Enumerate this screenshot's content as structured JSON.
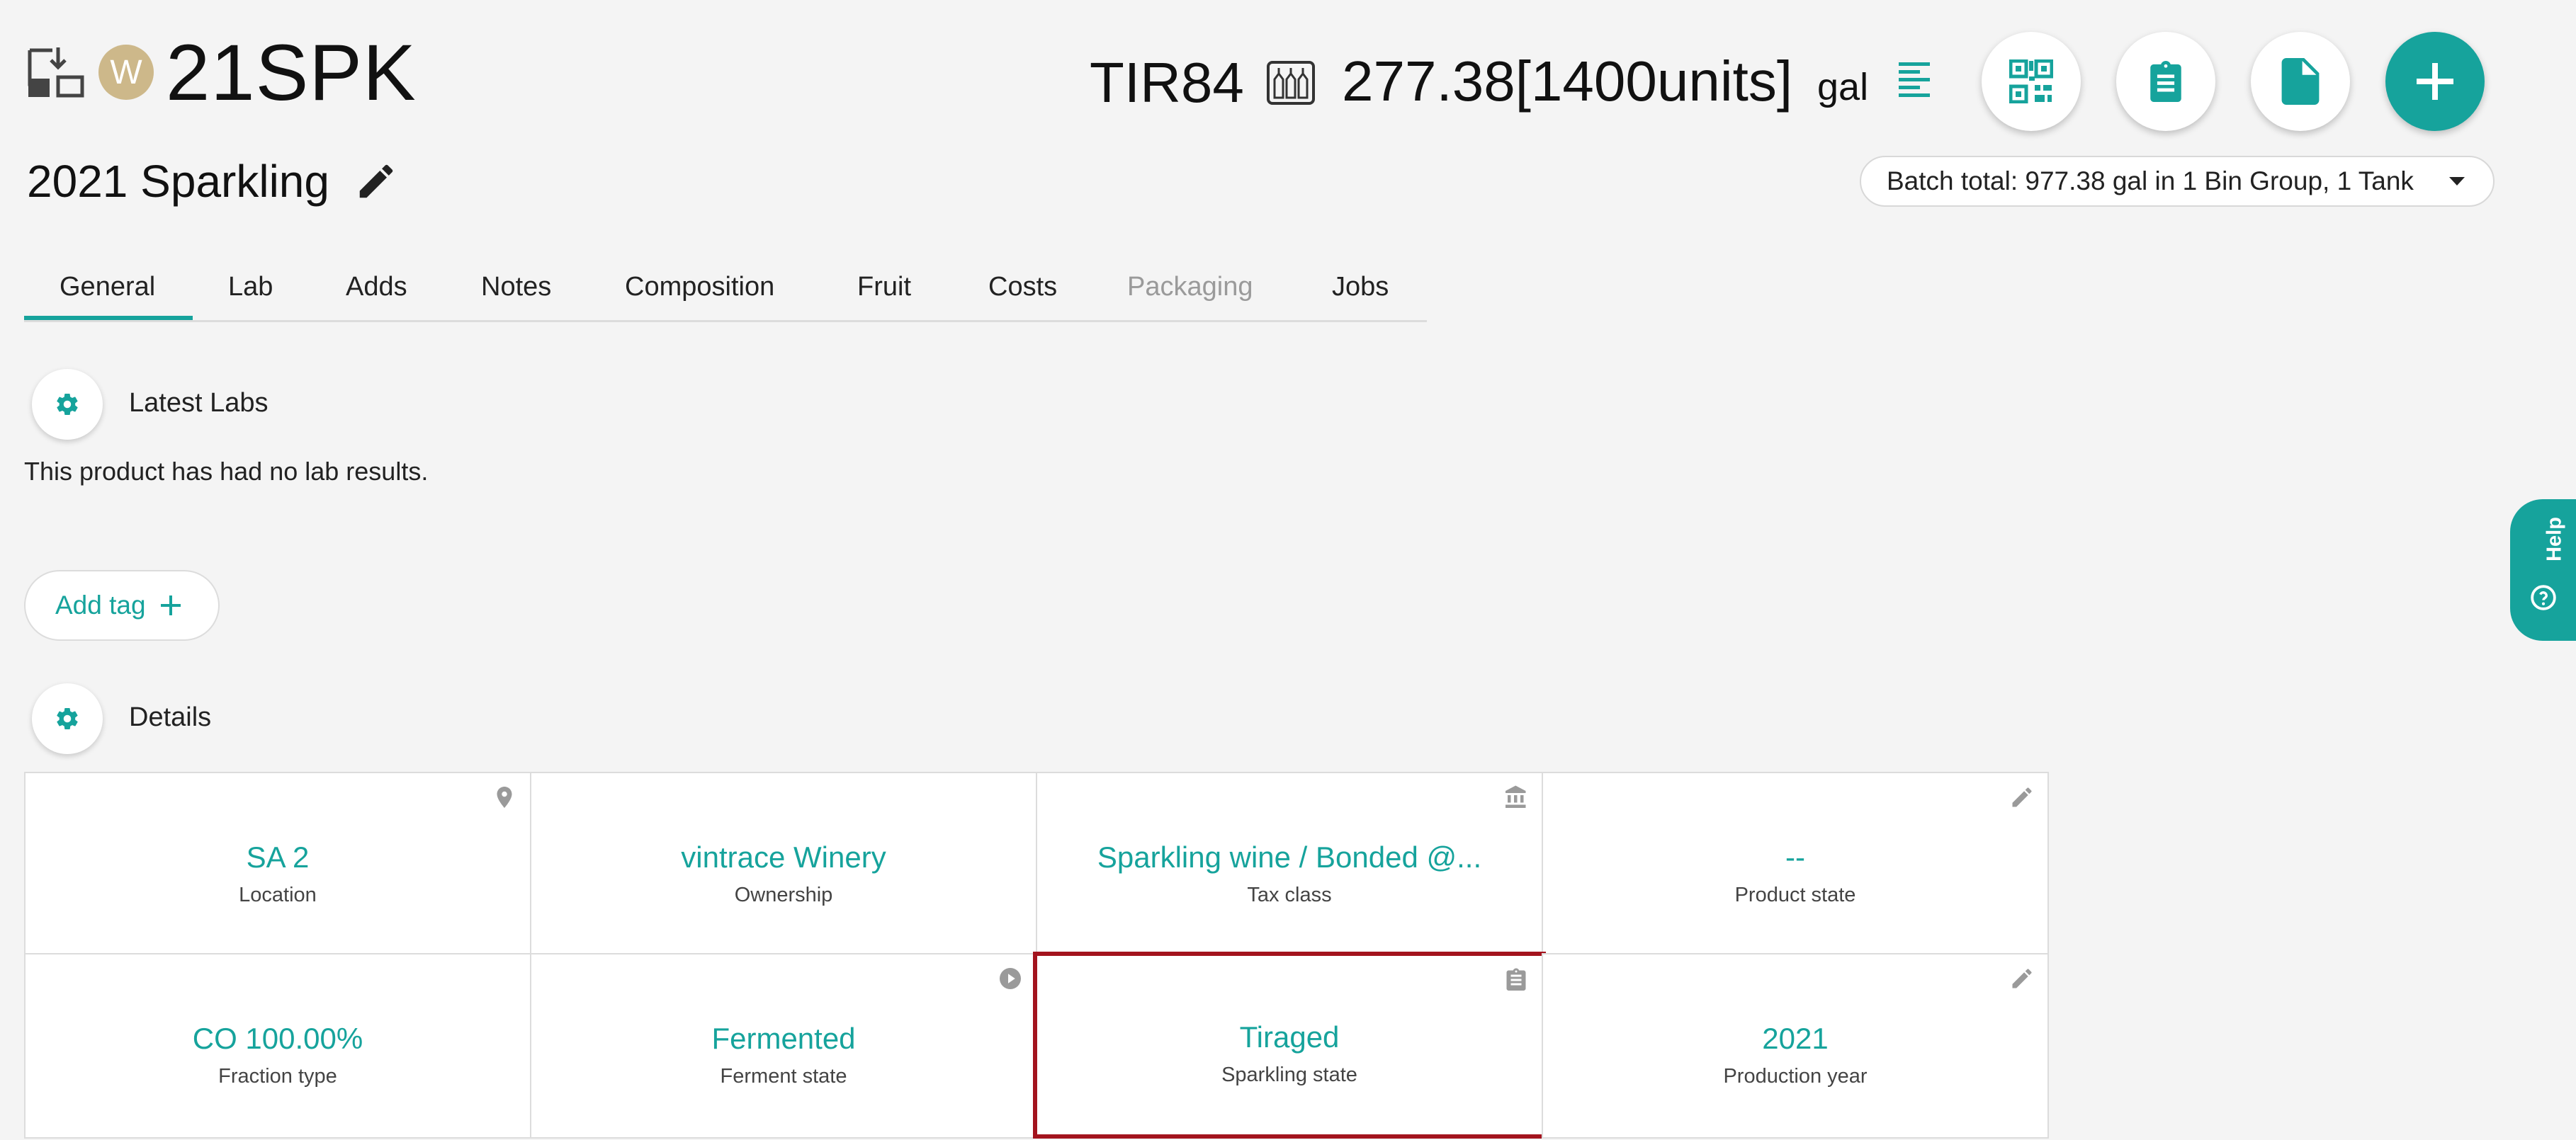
{
  "header": {
    "icon": "transfer-icon",
    "avatar_initial": "W",
    "product_code": "21SPK",
    "product_name": "2021 Sparkling",
    "vessel_code": "TIR84",
    "vessel_icon": "bottles-icon",
    "volume": "277.38[1400units]",
    "unit": "gal"
  },
  "actions": {
    "qr": "qr-code-icon",
    "clipboard": "clipboard-icon",
    "document": "document-icon",
    "add": "plus-icon"
  },
  "batch": {
    "label": "Batch total: 977.38 gal in 1 Bin Group, 1 Tank"
  },
  "tabs": [
    {
      "label": "General",
      "active": true,
      "disabled": false
    },
    {
      "label": "Lab",
      "active": false,
      "disabled": false
    },
    {
      "label": "Adds",
      "active": false,
      "disabled": false
    },
    {
      "label": "Notes",
      "active": false,
      "disabled": false
    },
    {
      "label": "Composition",
      "active": false,
      "disabled": false
    },
    {
      "label": "Fruit",
      "active": false,
      "disabled": false
    },
    {
      "label": "Costs",
      "active": false,
      "disabled": false
    },
    {
      "label": "Packaging",
      "active": false,
      "disabled": true
    },
    {
      "label": "Jobs",
      "active": false,
      "disabled": false
    }
  ],
  "latest_labs": {
    "title": "Latest Labs",
    "empty_message": "This product has had no lab results."
  },
  "tags": {
    "add_label": "Add tag"
  },
  "details": {
    "title": "Details",
    "cells": [
      {
        "value": "SA 2",
        "label": "Location",
        "icon": "location-pin-icon"
      },
      {
        "value": "vintrace Winery",
        "label": "Ownership",
        "icon": ""
      },
      {
        "value": "Sparkling wine / Bonded @...",
        "label": "Tax class",
        "icon": "bank-icon"
      },
      {
        "value": "--",
        "label": "Product state",
        "icon": "pencil-icon"
      },
      {
        "value": "CO 100.00%",
        "label": "Fraction type",
        "icon": ""
      },
      {
        "value": "Fermented",
        "label": "Ferment state",
        "icon": "play-circle-icon"
      },
      {
        "value": "Tiraged",
        "label": "Sparkling state",
        "icon": "clipboard-icon",
        "selected": true
      },
      {
        "value": "2021",
        "label": "Production year",
        "icon": "pencil-icon"
      }
    ]
  },
  "help": {
    "label": "Help"
  },
  "colors": {
    "accent": "#16a39c",
    "avatar": "#cdb88a",
    "selected_border": "#a3141e",
    "background": "#f4f4f4"
  }
}
